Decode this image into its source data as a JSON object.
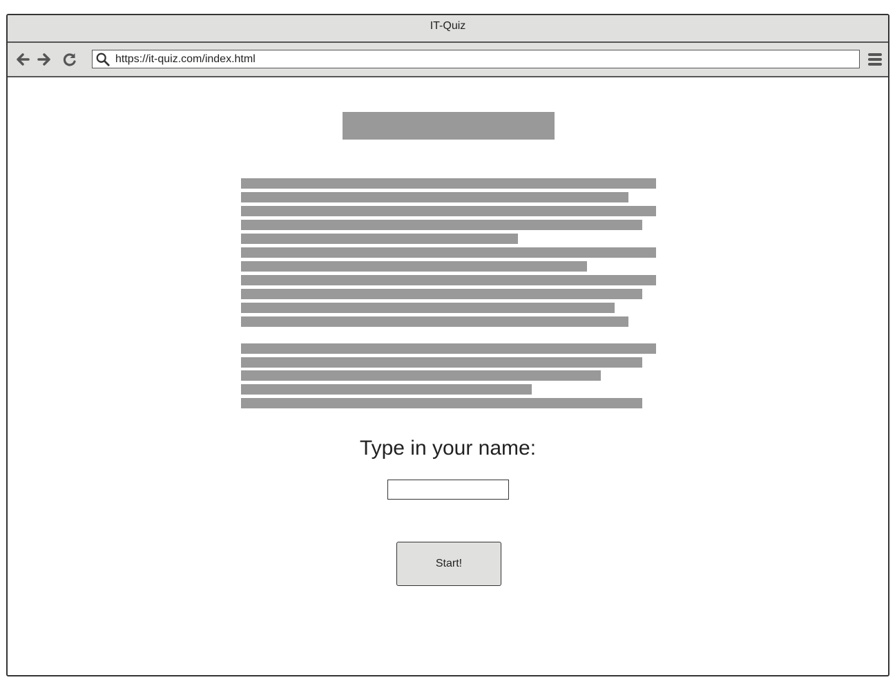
{
  "window": {
    "title": "IT-Quiz"
  },
  "toolbar": {
    "back_icon": "arrow-left-icon",
    "forward_icon": "arrow-right-icon",
    "reload_icon": "reload-icon",
    "search_icon": "search-icon",
    "menu_icon": "hamburger-menu-icon",
    "url": "https://it-quiz.com/index.html"
  },
  "main": {
    "prompt": "Type in your name:",
    "name_input_value": "",
    "start_label": "Start!"
  },
  "colors": {
    "chrome": "#e0e0df",
    "placeholder": "#999999",
    "border": "#333333"
  }
}
